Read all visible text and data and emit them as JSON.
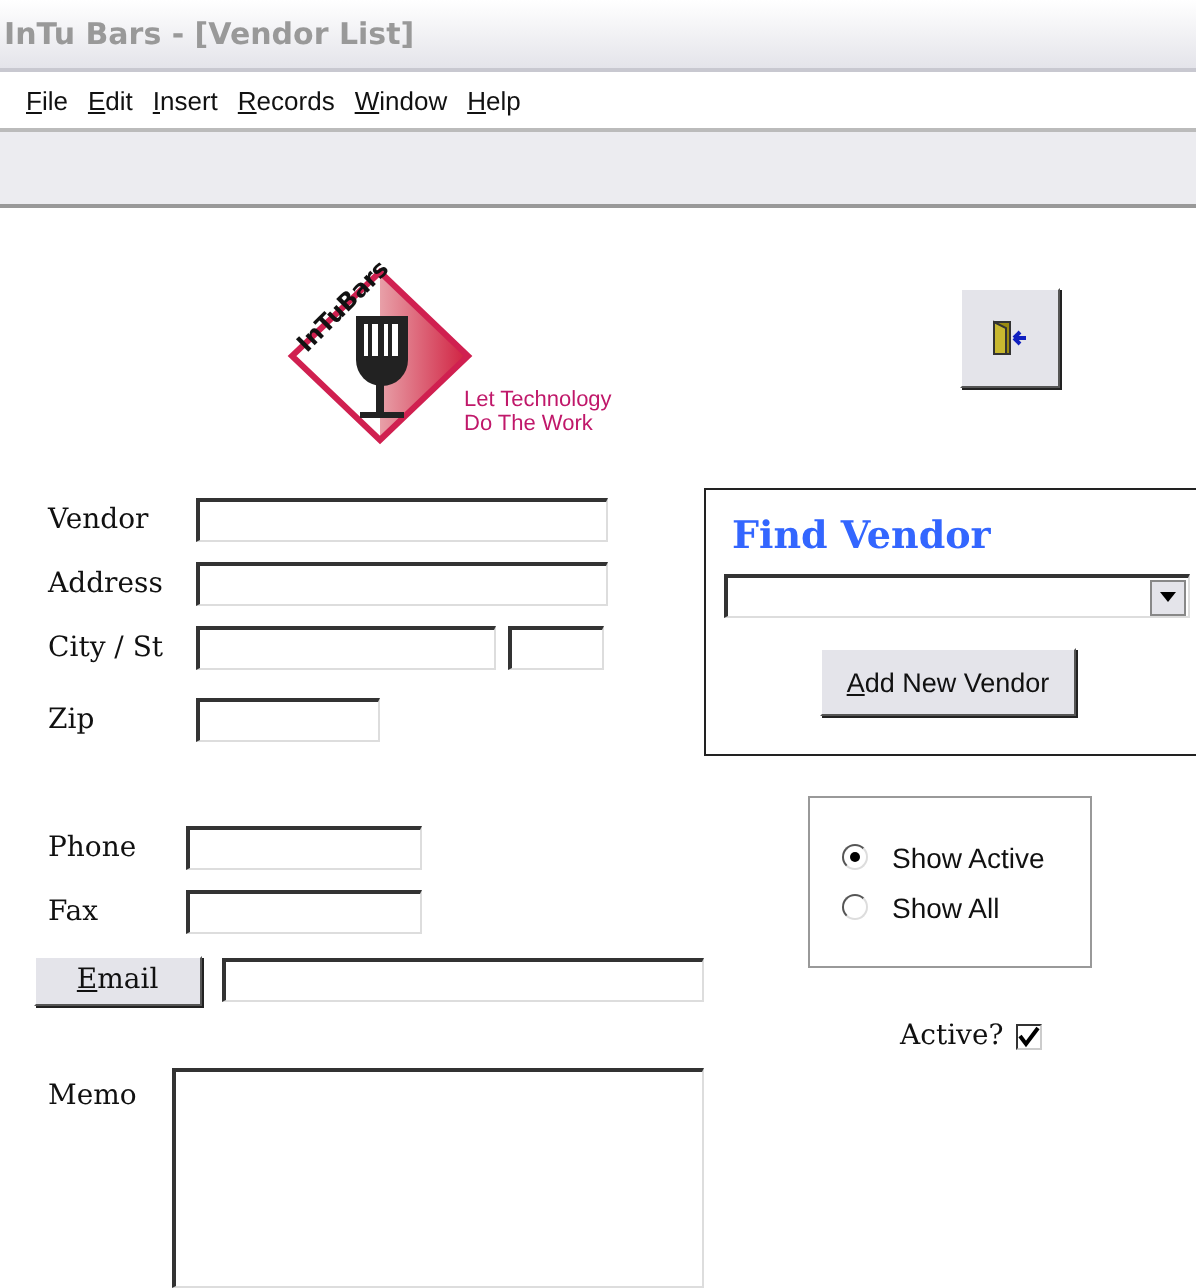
{
  "window": {
    "title": "InTu Bars - [Vendor List]"
  },
  "menu": [
    {
      "hotkey": "F",
      "rest": "ile"
    },
    {
      "hotkey": "E",
      "rest": "dit"
    },
    {
      "hotkey": "I",
      "rest": "nsert"
    },
    {
      "hotkey": "R",
      "rest": "ecords"
    },
    {
      "hotkey": "W",
      "rest": "indow"
    },
    {
      "hotkey": "H",
      "rest": "elp"
    }
  ],
  "logo": {
    "brand": "InTuBars",
    "tagline_1": "Let Technology",
    "tagline_2": "Do The Work"
  },
  "fields": {
    "vendor": "Vendor",
    "address": "Address",
    "city_st": "City / St",
    "zip": "Zip",
    "phone": "Phone",
    "fax": "Fax",
    "memo": "Memo"
  },
  "email_button": {
    "hotkey": "E",
    "rest": "mail"
  },
  "find_vendor": {
    "title": "Find Vendor",
    "add_button": {
      "hotkey": "A",
      "rest": "dd New Vendor"
    }
  },
  "filter": [
    {
      "label": "Show Active",
      "selected": true
    },
    {
      "label": "Show All",
      "selected": false
    }
  ],
  "active": {
    "label": "Active?",
    "checked": true
  }
}
